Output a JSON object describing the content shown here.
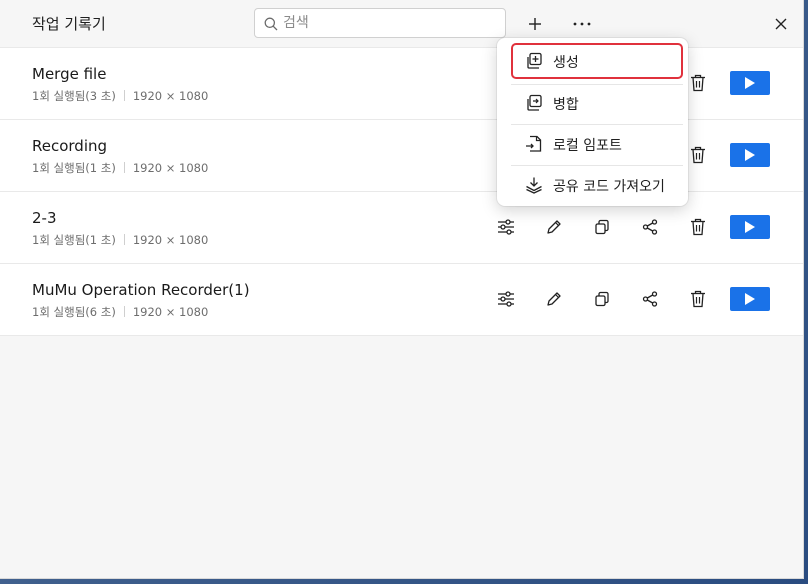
{
  "app": {
    "title": "작업 기록기"
  },
  "search": {
    "placeholder": "검색",
    "value": ""
  },
  "toolbar": {
    "add_icon": "plus-icon",
    "more_icon": "ellipsis-icon",
    "close_icon": "close-icon"
  },
  "records": [
    {
      "name": "Merge file",
      "runs": "1회 실행됨(3 초)",
      "resolution": "1920 × 1080"
    },
    {
      "name": "Recording",
      "runs": "1회 실행됨(1 초)",
      "resolution": "1920 × 1080"
    },
    {
      "name": "2-3",
      "runs": "1회 실행됨(1 초)",
      "resolution": "1920 × 1080"
    },
    {
      "name": "MuMu Operation Recorder(1)",
      "runs": "1회 실행됨(6 초)",
      "resolution": "1920 × 1080"
    }
  ],
  "menu": {
    "items": [
      {
        "label": "생성",
        "icon": "create-icon"
      },
      {
        "label": "병합",
        "icon": "merge-icon"
      },
      {
        "label": "로컬 임포트",
        "icon": "local-import-icon"
      },
      {
        "label": "공유 코드 가져오기",
        "icon": "download-share-code-icon"
      }
    ]
  },
  "colors": {
    "accent": "#1a72e8",
    "highlight": "#e0313c"
  }
}
